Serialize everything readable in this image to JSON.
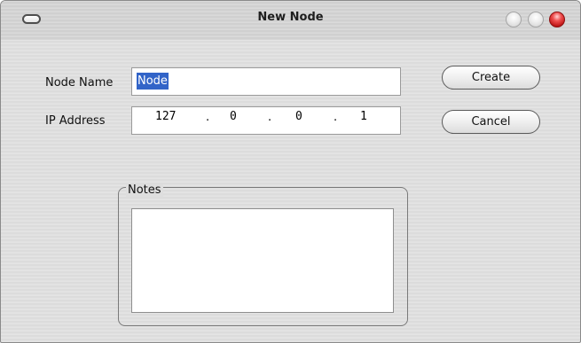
{
  "window": {
    "title": "New Node"
  },
  "form": {
    "node_name_label": "Node Name",
    "node_name_value": "Node",
    "ip_label": "IP Address",
    "ip_octets": [
      "127",
      "0",
      "0",
      "1"
    ],
    "ip_separator": "."
  },
  "buttons": {
    "create_label": "Create",
    "cancel_label": "Cancel"
  },
  "notes": {
    "group_label": "Notes",
    "value": ""
  }
}
